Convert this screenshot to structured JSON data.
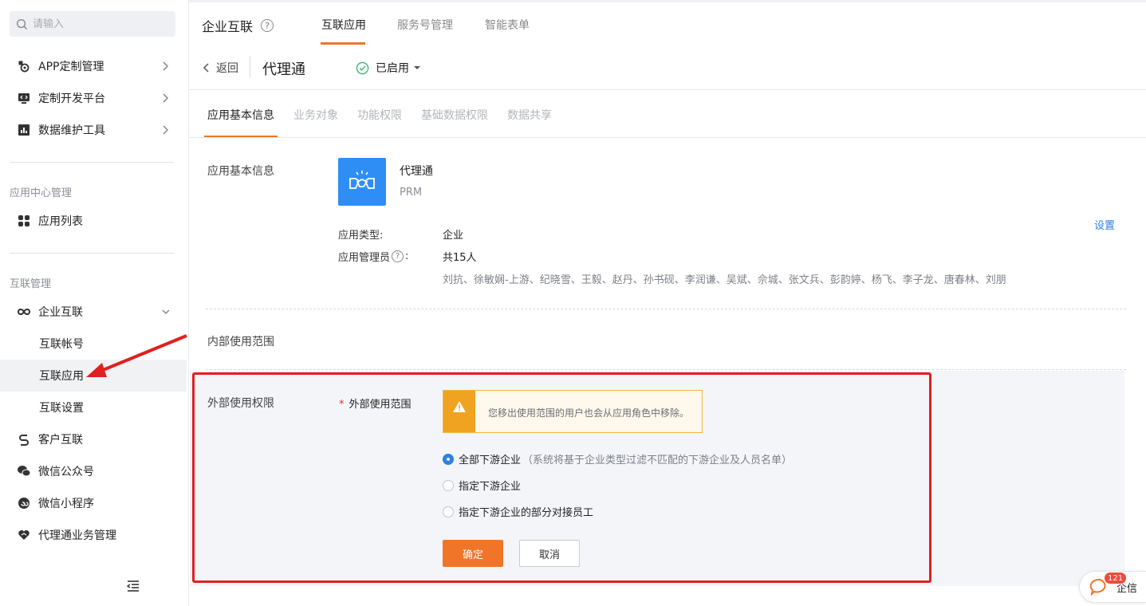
{
  "sidebar": {
    "search_placeholder": "请输入",
    "top_items": [
      {
        "label": "APP定制管理",
        "icon": "app-custom-icon"
      },
      {
        "label": "定制开发平台",
        "icon": "dev-platform-icon"
      },
      {
        "label": "数据维护工具",
        "icon": "data-tool-icon"
      }
    ],
    "group_app_center": "应用中心管理",
    "app_list": "应用列表",
    "group_interconnect": "互联管理",
    "enterprise_interconnect": "企业互联",
    "sub_items": [
      "互联帐号",
      "互联应用",
      "互联设置"
    ],
    "active_sub": "互联应用",
    "bottom_items": [
      "客户互联",
      "微信公众号",
      "微信小程序",
      "代理通业务管理"
    ]
  },
  "header": {
    "title": "企业互联",
    "tabs": [
      "互联应用",
      "服务号管理",
      "智能表单"
    ],
    "active_tab": "互联应用",
    "back_label": "返回",
    "app_name": "代理通",
    "status_label": "已启用"
  },
  "sub_tabs": [
    "应用基本信息",
    "业务对象",
    "功能权限",
    "基础数据权限",
    "数据共享"
  ],
  "basic": {
    "section_label": "应用基本信息",
    "app_title": "代理通",
    "app_code": "PRM",
    "settings_link": "设置",
    "type_label": "应用类型:",
    "type_value": "企业",
    "admin_label_1": "应用管理员",
    "admin_label_2": ":",
    "admin_count": "共15人",
    "admin_names": "刘抗、徐敏娴-上游、纪晓雪、王毅、赵丹、孙书砚、李润谦、吴斌、佘城、张文兵、彭韵婷、杨飞、李子龙、唐春林、刘朋"
  },
  "internal": {
    "section_label": "内部使用范围"
  },
  "external": {
    "section_label": "外部使用权限",
    "required_label": "外部使用范围",
    "warning": "您移出使用范围的用户也会从应用角色中移除。",
    "options": [
      {
        "label": "全部下游企业",
        "note": "（系统将基于企业类型过滤不匹配的下游企业及人员名单）",
        "checked": true
      },
      {
        "label": "指定下游企业",
        "note": "",
        "checked": false
      },
      {
        "label": "指定下游企业的部分对接员工",
        "note": "",
        "checked": false
      }
    ],
    "ok_label": "确定",
    "cancel_label": "取消"
  },
  "qixin": {
    "badge": "121",
    "label": "企信"
  },
  "colors": {
    "accent": "#f07528",
    "link": "#2f7fe0",
    "highlight": "#e02020",
    "app_icon": "#2f8ef5"
  }
}
